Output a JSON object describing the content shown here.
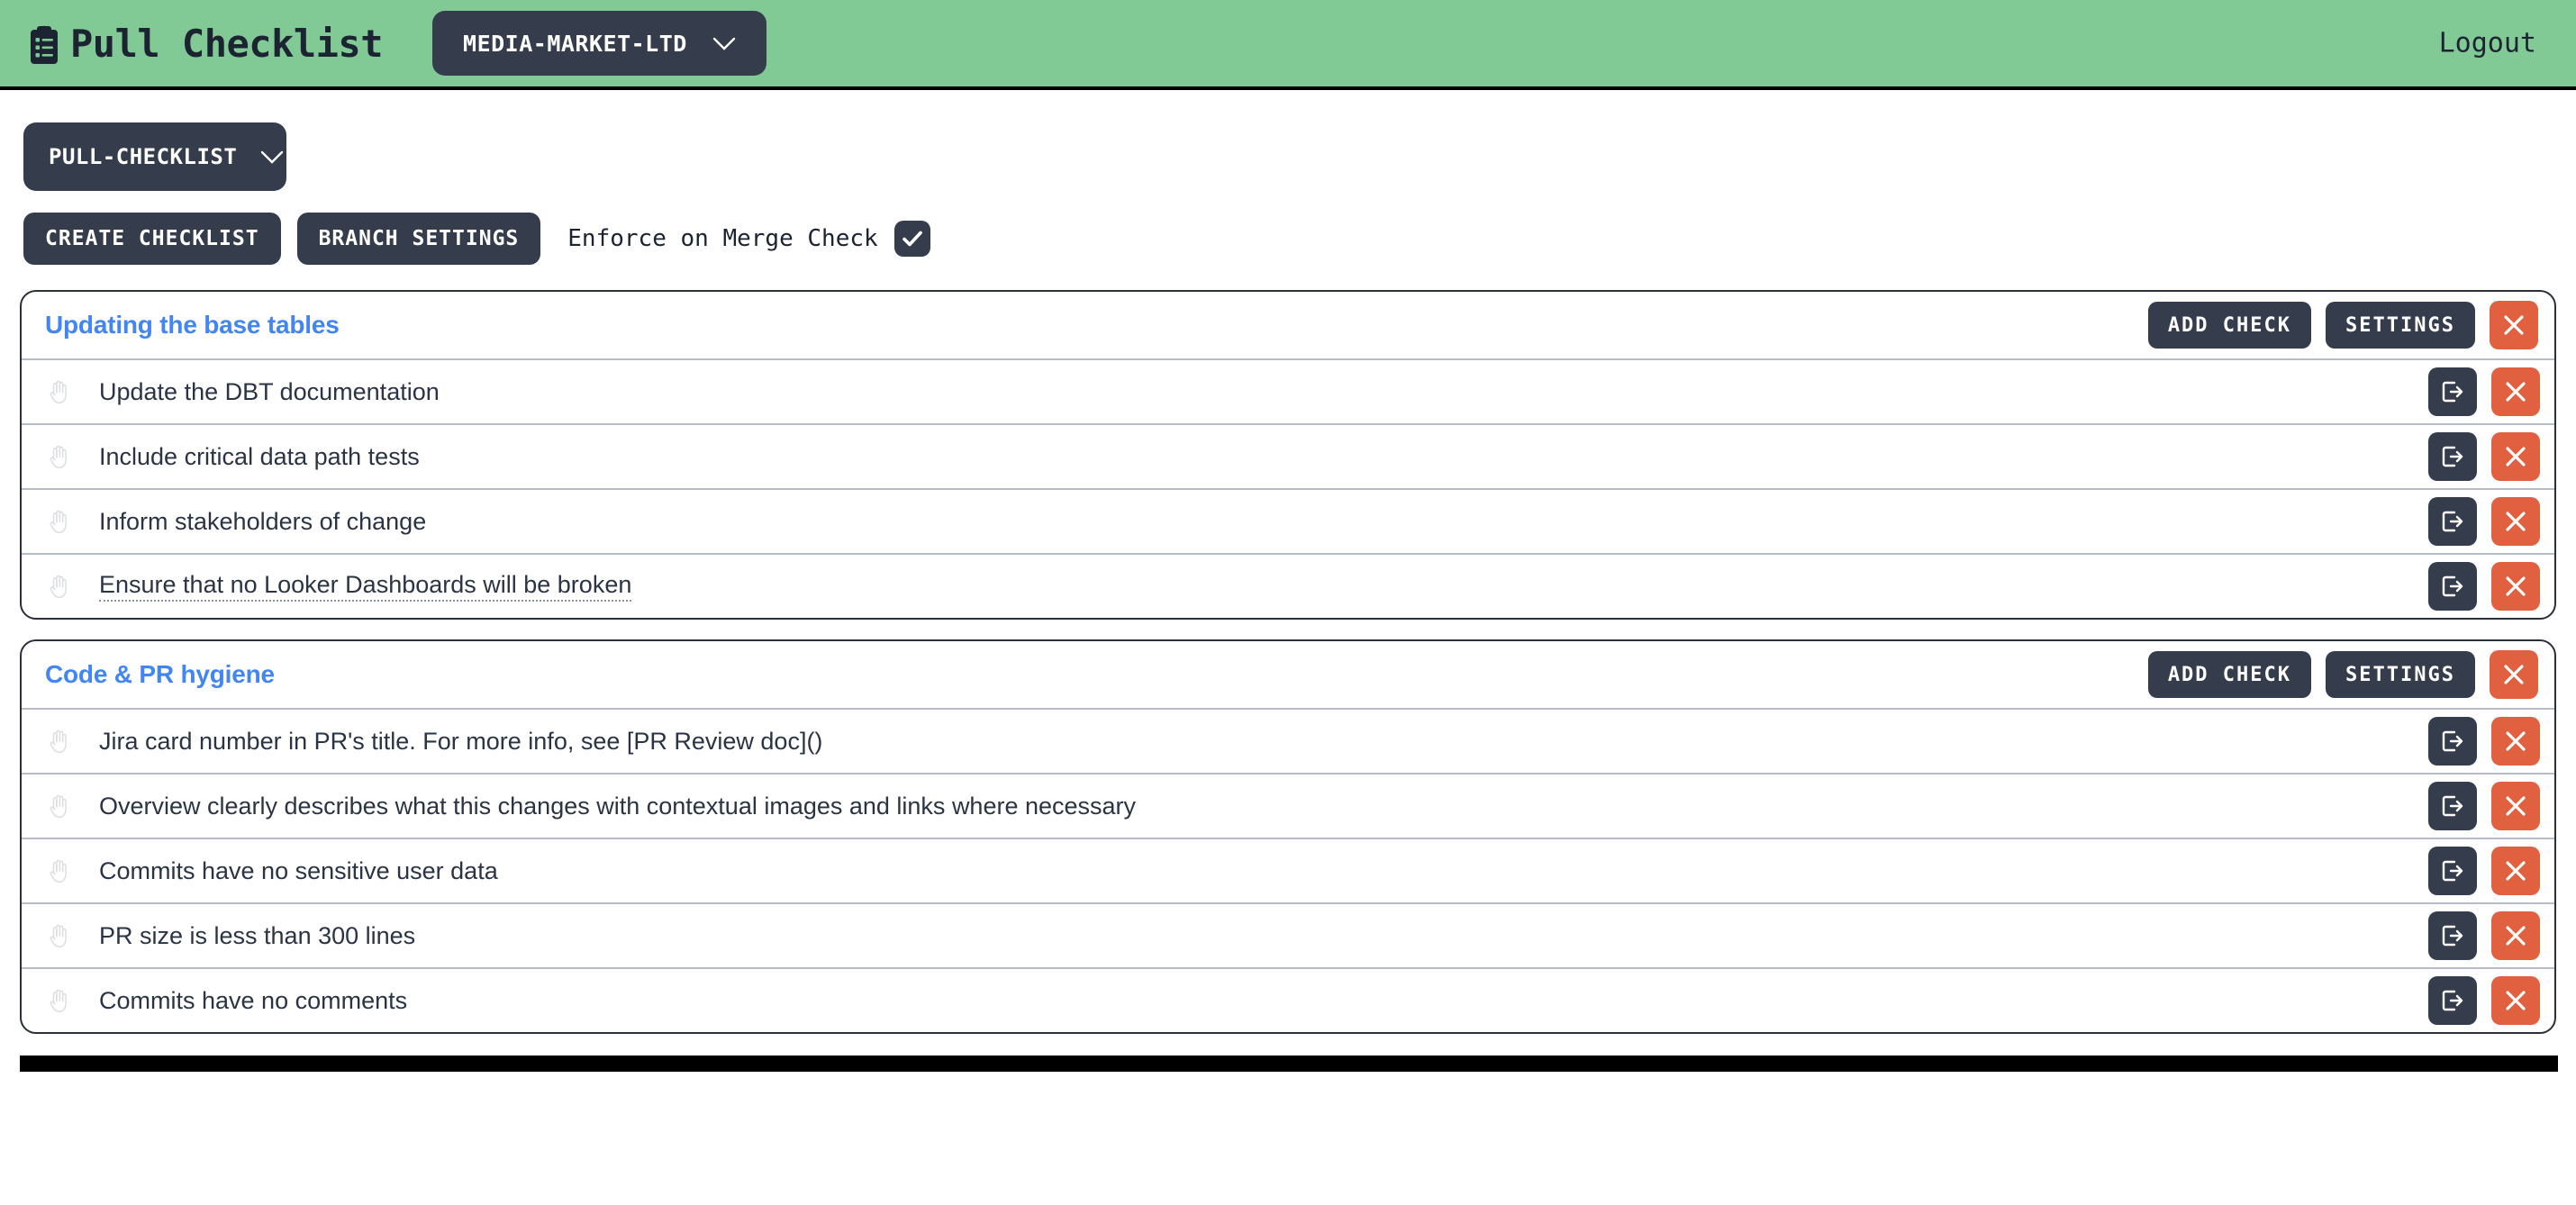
{
  "header": {
    "brand_icon": "clipboard-icon",
    "brand_title": "Pull Checklist",
    "org_label": "MEDIA-MARKET-LTD",
    "org_chevron_icon": "chevron-down-icon",
    "logout_label": "Logout",
    "background_color": "#81c995"
  },
  "toolbar": {
    "branch_label": "PULL-CHECKLIST",
    "branch_chevron_icon": "chevron-down-icon",
    "create_checklist_label": "CREATE CHECKLIST",
    "branch_settings_label": "BRANCH SETTINGS",
    "enforce_label": "Enforce on Merge Check",
    "enforce_checked": true,
    "check_icon": "check-icon"
  },
  "common": {
    "add_check_label": "ADD CHECK",
    "settings_label": "SETTINGS",
    "delete_icon": "close-icon",
    "open_icon": "external-link-icon",
    "grip_icon": "raised-hand-icon",
    "accent_color": "#4285f4",
    "danger_color": "#e0603f",
    "dark_color": "#353d4d"
  },
  "checklists": [
    {
      "title": "Updating the base tables",
      "items": [
        {
          "text": "Update the DBT documentation",
          "editing": false
        },
        {
          "text": "Include critical data path tests",
          "editing": false
        },
        {
          "text": "Inform stakeholders of change",
          "editing": false
        },
        {
          "text": "Ensure that no Looker Dashboards will be broken",
          "editing": true
        }
      ]
    },
    {
      "title": "Code & PR hygiene",
      "items": [
        {
          "text": "Jira card number in PR's title. For more info, see [PR Review doc]()",
          "editing": false
        },
        {
          "text": "Overview clearly describes what this changes with contextual images and links where necessary",
          "editing": false
        },
        {
          "text": "Commits have no sensitive user data",
          "editing": false
        },
        {
          "text": "PR size is less than 300 lines",
          "editing": false
        },
        {
          "text": "Commits have no comments",
          "editing": false
        }
      ]
    }
  ]
}
